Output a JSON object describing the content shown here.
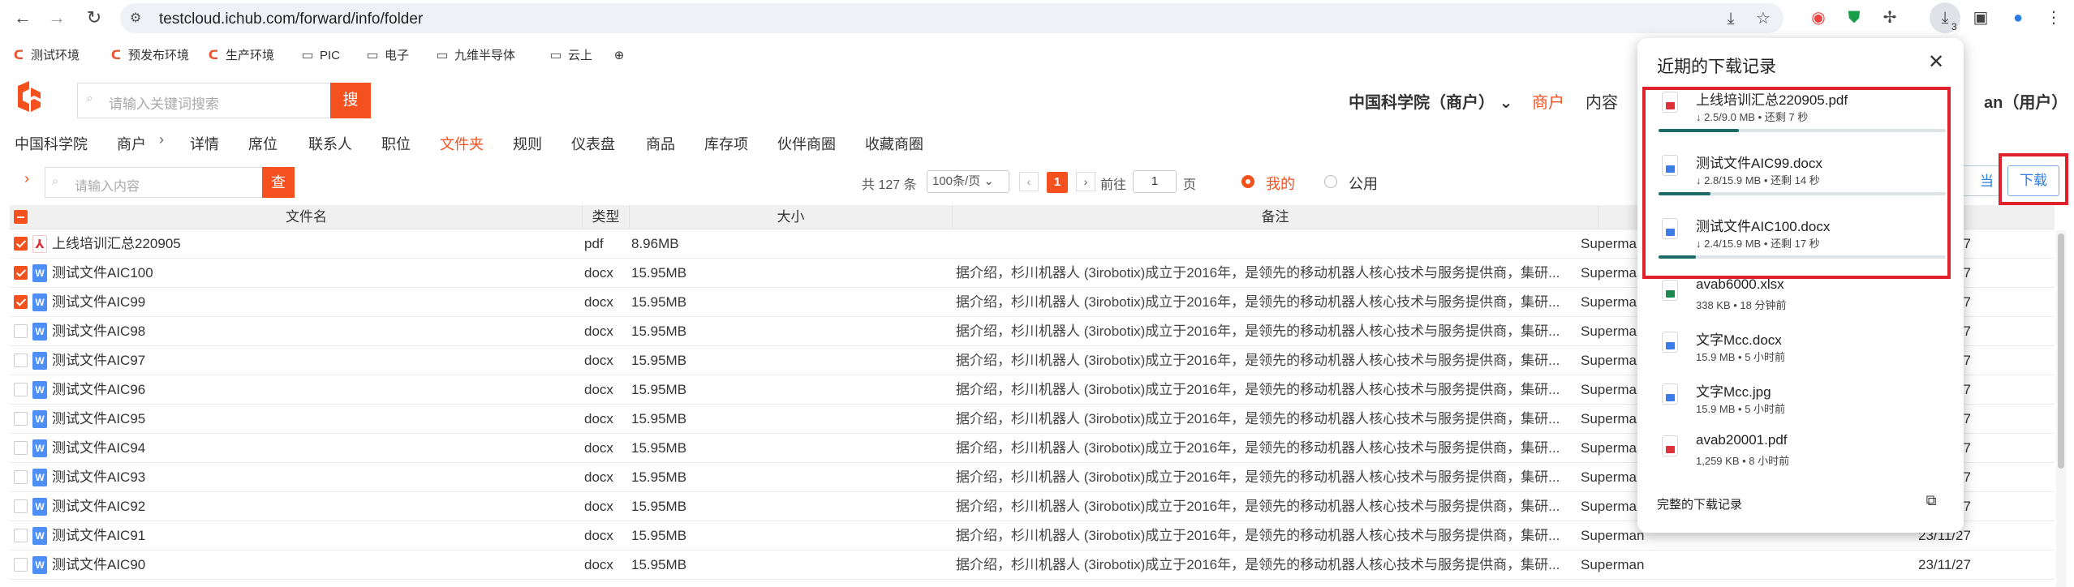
{
  "browser": {
    "url": "testcloud.ichub.com/forward/info/folder",
    "download_count": "3",
    "bookmarks": [
      {
        "label": "测试环境",
        "icon": "company-logo-icon"
      },
      {
        "label": "预发布环境",
        "icon": "company-logo-icon"
      },
      {
        "label": "生产环境",
        "icon": "company-logo-icon"
      },
      {
        "label": "PIC",
        "icon": "folder-icon"
      },
      {
        "label": "电子",
        "icon": "folder-icon"
      },
      {
        "label": "九维半导体",
        "icon": "folder-icon"
      },
      {
        "label": "云上",
        "icon": "folder-icon"
      }
    ]
  },
  "header": {
    "search_placeholder": "请输入关键词搜索",
    "search_button": "搜",
    "org_name": "中国科学院（商户）",
    "links": [
      "商户",
      "内容"
    ],
    "user_fragment": "an（用户）"
  },
  "subnav": {
    "items": [
      "中国科学院",
      "商户",
      "详情",
      "席位",
      "联系人",
      "职位",
      "文件夹",
      "规则",
      "仪表盘",
      "商品",
      "库存项",
      "伙伴商圈",
      "收藏商圈"
    ],
    "active": "文件夹"
  },
  "toolbar": {
    "filter_placeholder": "请输入内容",
    "filter_button": "查",
    "total": "共 127 条",
    "page_size": "100条/页",
    "current_page": "1",
    "goto_label": "前往",
    "goto_value": "1",
    "page_unit": "页",
    "radio_mine": "我的",
    "radio_public": "公用",
    "partial_button": "当",
    "download_button": "下载"
  },
  "table": {
    "columns": [
      "文件名",
      "类型",
      "大小",
      "备注"
    ],
    "remark": "据介绍，杉川机器人 (3irobotix)成立于2016年，是领先的移动机器人核心技术与服务提供商，集研...",
    "rows": [
      {
        "name": "上线培训汇总220905",
        "type": "pdf",
        "size": "8.96MB",
        "remark": "",
        "owner": "Superman",
        "date": "23/11/27",
        "checked": true
      },
      {
        "name": "测试文件AIC100",
        "type": "docx",
        "size": "15.95MB",
        "remark": "据介绍，杉川机器人 (3irobotix)成立于2016年，是领先的移动机器人核心技术与服务提供商，集研...",
        "owner": "Superman",
        "date": "23/11/27",
        "checked": true
      },
      {
        "name": "测试文件AIC99",
        "type": "docx",
        "size": "15.95MB",
        "remark": "据介绍，杉川机器人 (3irobotix)成立于2016年，是领先的移动机器人核心技术与服务提供商，集研...",
        "owner": "Superman",
        "date": "23/11/27",
        "checked": true
      },
      {
        "name": "测试文件AIC98",
        "type": "docx",
        "size": "15.95MB",
        "remark": "据介绍，杉川机器人 (3irobotix)成立于2016年，是领先的移动机器人核心技术与服务提供商，集研...",
        "owner": "Superman",
        "date": "23/11/27",
        "checked": false
      },
      {
        "name": "测试文件AIC97",
        "type": "docx",
        "size": "15.95MB",
        "remark": "据介绍，杉川机器人 (3irobotix)成立于2016年，是领先的移动机器人核心技术与服务提供商，集研...",
        "owner": "Superman",
        "date": "23/11/27",
        "checked": false
      },
      {
        "name": "测试文件AIC96",
        "type": "docx",
        "size": "15.95MB",
        "remark": "据介绍，杉川机器人 (3irobotix)成立于2016年，是领先的移动机器人核心技术与服务提供商，集研...",
        "owner": "Superman",
        "date": "23/11/27",
        "checked": false
      },
      {
        "name": "测试文件AIC95",
        "type": "docx",
        "size": "15.95MB",
        "remark": "据介绍，杉川机器人 (3irobotix)成立于2016年，是领先的移动机器人核心技术与服务提供商，集研...",
        "owner": "Superman",
        "date": "23/11/27",
        "checked": false
      },
      {
        "name": "测试文件AIC94",
        "type": "docx",
        "size": "15.95MB",
        "remark": "据介绍，杉川机器人 (3irobotix)成立于2016年，是领先的移动机器人核心技术与服务提供商，集研...",
        "owner": "Superman",
        "date": "23/11/27",
        "checked": false
      },
      {
        "name": "测试文件AIC93",
        "type": "docx",
        "size": "15.95MB",
        "remark": "据介绍，杉川机器人 (3irobotix)成立于2016年，是领先的移动机器人核心技术与服务提供商，集研...",
        "owner": "Superman",
        "date": "23/11/27",
        "checked": false
      },
      {
        "name": "测试文件AIC92",
        "type": "docx",
        "size": "15.95MB",
        "remark": "据介绍，杉川机器人 (3irobotix)成立于2016年，是领先的移动机器人核心技术与服务提供商，集研...",
        "owner": "Superman",
        "date": "23/11/27",
        "checked": false
      },
      {
        "name": "测试文件AIC91",
        "type": "docx",
        "size": "15.95MB",
        "remark": "据介绍，杉川机器人 (3irobotix)成立于2016年，是领先的移动机器人核心技术与服务提供商，集研...",
        "owner": "Superman",
        "date": "23/11/27",
        "checked": false
      },
      {
        "name": "测试文件AIC90",
        "type": "docx",
        "size": "15.95MB",
        "remark": "据介绍，杉川机器人 (3irobotix)成立于2016年，是领先的移动机器人核心技术与服务提供商，集研...",
        "owner": "Superman",
        "date": "23/11/27",
        "checked": false
      }
    ]
  },
  "downloads": {
    "title": "近期的下载记录",
    "full_history": "完整的下载记录",
    "items": [
      {
        "name": "上线培训汇总220905.pdf",
        "status": "↓ 2.5/9.0 MB • 还剩 7 秒",
        "kind": "pdf",
        "progress": 0.28,
        "in_progress": true
      },
      {
        "name": "测试文件AIC99.docx",
        "status": "↓ 2.8/15.9 MB • 还剩 14 秒",
        "kind": "doc",
        "progress": 0.18,
        "in_progress": true
      },
      {
        "name": "测试文件AIC100.docx",
        "status": "↓ 2.4/15.9 MB • 还剩 17 秒",
        "kind": "doc",
        "progress": 0.13,
        "in_progress": true
      },
      {
        "name": "avab6000.xlsx",
        "status": "338 KB • 18 分钟前",
        "kind": "xls",
        "progress": 1,
        "in_progress": false
      },
      {
        "name": "文字Mcc.docx",
        "status": "15.9 MB • 5 小时前",
        "kind": "doc",
        "progress": 1,
        "in_progress": false
      },
      {
        "name": "文字Mcc.jpg",
        "status": "15.9 MB • 5 小时前",
        "kind": "img",
        "progress": 1,
        "in_progress": false
      },
      {
        "name": "avab20001.pdf",
        "status": "1,259 KB • 8 小时前",
        "kind": "pdf",
        "progress": 1,
        "in_progress": false
      }
    ]
  },
  "colors": {
    "accent": "#f4511e",
    "link": "#2a7de1",
    "highlight": "#e0202a"
  }
}
